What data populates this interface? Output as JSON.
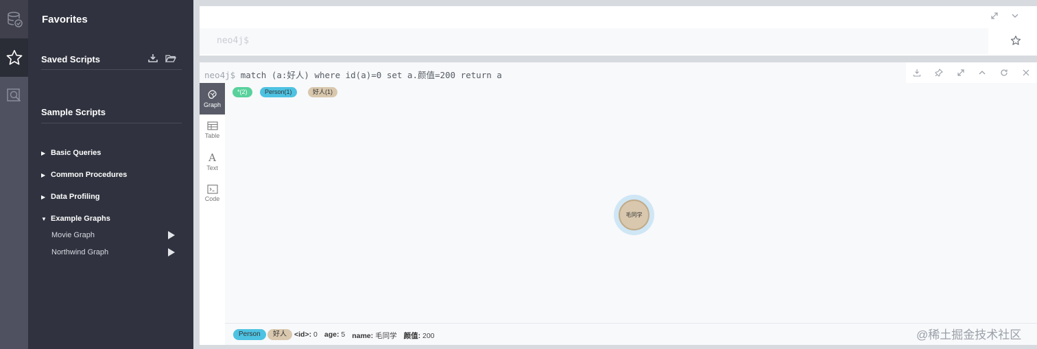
{
  "sidebar": {
    "rail": [
      "database-icon",
      "star-icon",
      "search-icon"
    ]
  },
  "drawer": {
    "title": "Favorites",
    "saved_scripts": "Saved Scripts",
    "sample_scripts": "Sample Scripts",
    "folders": [
      {
        "label": "Basic Queries",
        "expanded": false
      },
      {
        "label": "Common Procedures",
        "expanded": false
      },
      {
        "label": "Data Profiling",
        "expanded": false
      },
      {
        "label": "Example Graphs",
        "expanded": true
      }
    ],
    "graphs": [
      "Movie Graph",
      "Northwind Graph"
    ]
  },
  "editor": {
    "prompt": "neo4j$"
  },
  "frame": {
    "prompt": "neo4j$",
    "command": "match (a:好人) where id(a)=0 set a.颜值=200 return a",
    "tabs": [
      "Graph",
      "Table",
      "Text",
      "Code"
    ],
    "labels": {
      "all": "*(2)",
      "person": "Person(1)",
      "good": "好人(1)"
    },
    "node": {
      "caption": "毛同学"
    },
    "footer": {
      "pill_person": "Person",
      "pill_good": "好人",
      "props": [
        {
          "key": "<id>:",
          "value": "0"
        },
        {
          "key": "age:",
          "value": "5"
        },
        {
          "key": "name:",
          "value": "毛同学"
        },
        {
          "key": "颜值:",
          "value": "200"
        }
      ]
    }
  },
  "watermark": "@稀土掘金技术社区",
  "colors": {
    "drawer_bg": "#30333f",
    "person": "#4dc2e2",
    "good": "#d9c8ae",
    "all": "#58d19c"
  }
}
